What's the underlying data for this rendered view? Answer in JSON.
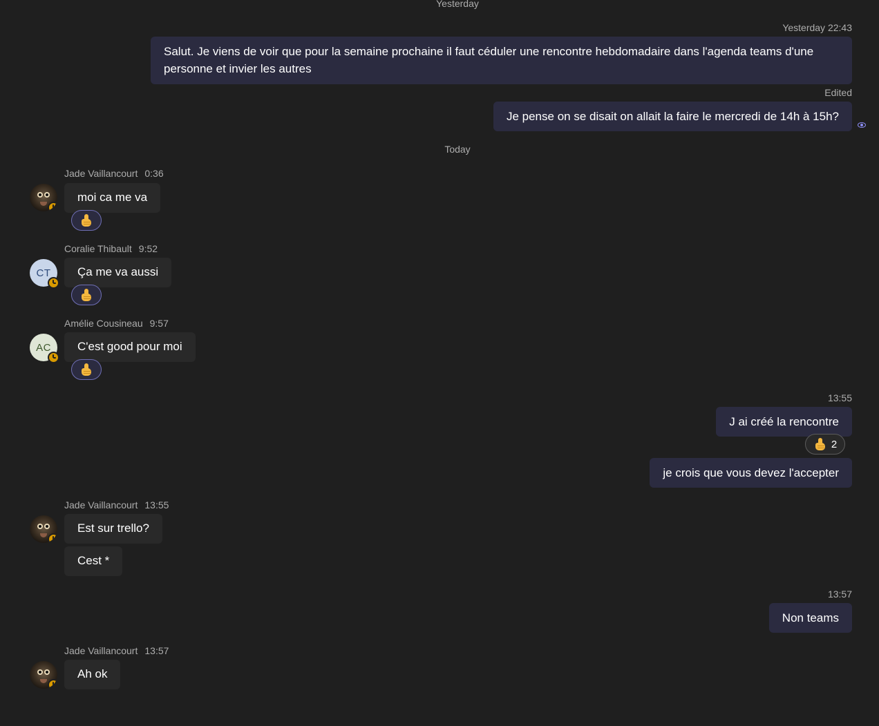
{
  "dividers": {
    "yesterday": "Yesterday",
    "today": "Today"
  },
  "outgoing": {
    "msg1": {
      "timestamp": "Yesterday 22:43",
      "text": "Salut. Je viens de voir que pour la semaine prochaine il faut céduler une rencontre hebdomadaire dans l'agenda teams d'une personne et invier les autres"
    },
    "msg2": {
      "edited_label": "Edited",
      "text": "Je pense on se disait on allait la faire le mercredi de 14h à 15h?"
    },
    "msg3": {
      "timestamp": "13:55",
      "text": "J ai créé la rencontre",
      "reaction": {
        "icon": "thumbs-up-icon",
        "count": "2"
      }
    },
    "msg4": {
      "text": "je crois que vous devez l'accepter"
    },
    "msg5": {
      "timestamp": "13:57",
      "text": "Non teams"
    }
  },
  "incoming": {
    "m1": {
      "sender": "Jade Vaillancourt",
      "time": "0:36",
      "text": "moi ca me va",
      "reaction_icon": "thumbs-up-icon"
    },
    "m2": {
      "sender": "Coralie Thibault",
      "initials": "CT",
      "time": "9:52",
      "text": "Ça me va aussi",
      "reaction_icon": "thumbs-up-icon"
    },
    "m3": {
      "sender": "Amélie Cousineau",
      "initials": "AC",
      "time": "9:57",
      "text": "C'est good pour moi",
      "reaction_icon": "thumbs-up-icon"
    },
    "m4": {
      "sender": "Jade Vaillancourt",
      "time": "13:55",
      "text": "Est sur trello?",
      "text2": "Cest *"
    },
    "m5": {
      "sender": "Jade Vaillancourt",
      "time": "13:57",
      "text": "Ah ok"
    }
  },
  "colors": {
    "background": "#1f1f1f",
    "outgoing_bubble": "#2b2b40",
    "incoming_bubble": "#292929",
    "status_away": "#d99a00",
    "accent": "#8b8cf2"
  }
}
